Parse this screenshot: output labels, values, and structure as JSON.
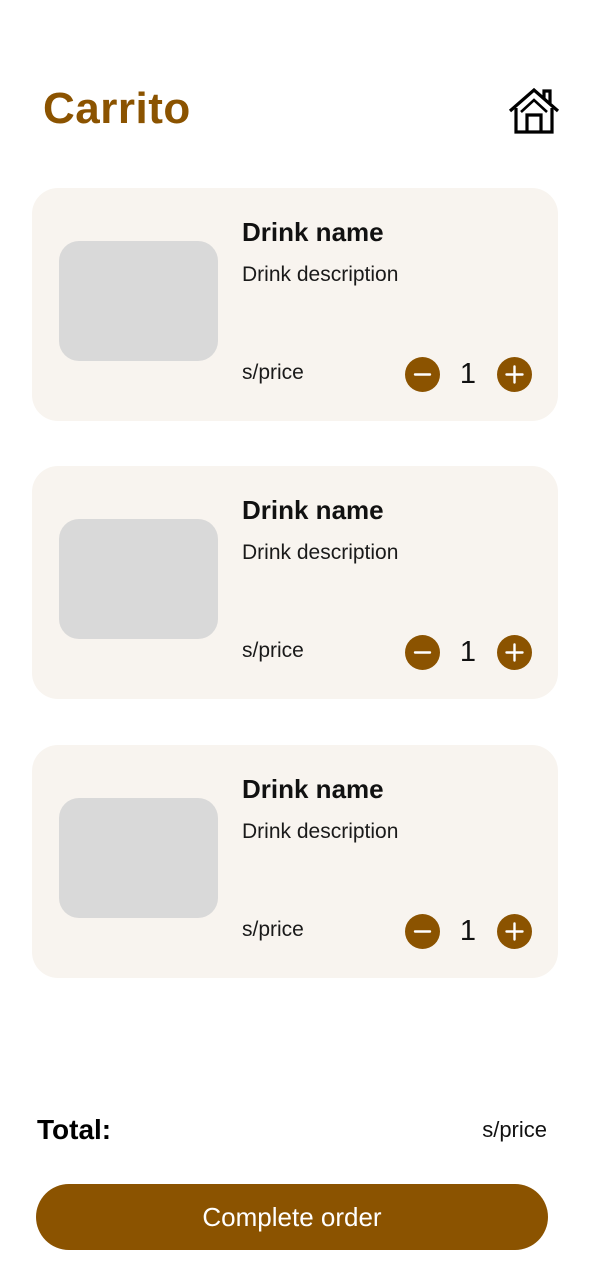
{
  "header": {
    "title": "Carrito",
    "home_icon": "home-icon"
  },
  "colors": {
    "accent": "#8B5300",
    "card_background": "#F8F4EF",
    "image_placeholder": "#D9D9D9",
    "text": "#111111"
  },
  "cart": {
    "items": [
      {
        "name": "Drink name",
        "description": "Drink description",
        "price": "s/price",
        "quantity": "1",
        "minus_icon": "minus-icon",
        "plus_icon": "plus-icon"
      },
      {
        "name": "Drink name",
        "description": "Drink description",
        "price": "s/price",
        "quantity": "1",
        "minus_icon": "minus-icon",
        "plus_icon": "plus-icon"
      },
      {
        "name": "Drink name",
        "description": "Drink description",
        "price": "s/price",
        "quantity": "1",
        "minus_icon": "minus-icon",
        "plus_icon": "plus-icon"
      }
    ]
  },
  "summary": {
    "total_label": "Total:",
    "total_value": "s/price"
  },
  "actions": {
    "complete_label": "Complete order"
  }
}
